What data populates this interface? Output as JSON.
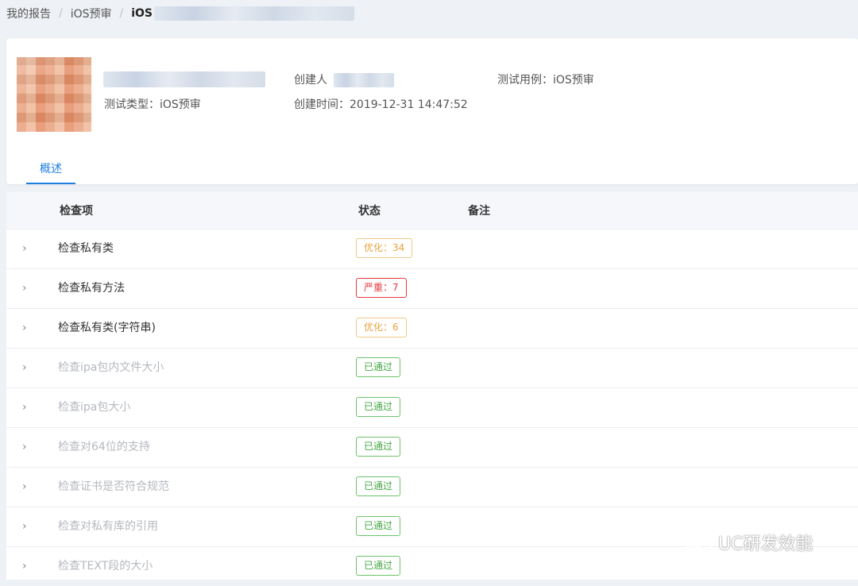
{
  "breadcrumb": {
    "items": [
      "我的报告",
      "iOS预审"
    ],
    "current": "iOS",
    "separator": "/"
  },
  "header": {
    "creator_label": "创建人",
    "test_case": "测试用例：iOS预审",
    "test_type": "测试类型：iOS预审",
    "created_time": "创建时间：2019-12-31 14:47:52"
  },
  "tabs": [
    {
      "label": "概述",
      "active": true
    }
  ],
  "table": {
    "columns": {
      "item": "检查项",
      "status": "状态",
      "note": "备注"
    },
    "rows": [
      {
        "name": "检查私有类",
        "status": "优化：34",
        "level": "warn"
      },
      {
        "name": "检查私有方法",
        "status": "严重：7",
        "level": "danger"
      },
      {
        "name": "检查私有类(字符串)",
        "status": "优化：6",
        "level": "warn"
      },
      {
        "name": "检查ipa包内文件大小",
        "status": "已通过",
        "level": "ok"
      },
      {
        "name": "检查ipa包大小",
        "status": "已通过",
        "level": "ok"
      },
      {
        "name": "检查对64位的支持",
        "status": "已通过",
        "level": "ok"
      },
      {
        "name": "检查证书是否符合规范",
        "status": "已通过",
        "level": "ok"
      },
      {
        "name": "检查对私有库的引用",
        "status": "已通过",
        "level": "ok"
      },
      {
        "name": "检查TEXT段的大小",
        "status": "已通过",
        "level": "ok"
      }
    ]
  },
  "watermark": {
    "text": "UC研发效能",
    "icon": "wechat-icon"
  },
  "colors": {
    "accent": "#1f7fe0",
    "warn": "#e6a23c",
    "danger": "#e4393c",
    "ok": "#45a845"
  }
}
